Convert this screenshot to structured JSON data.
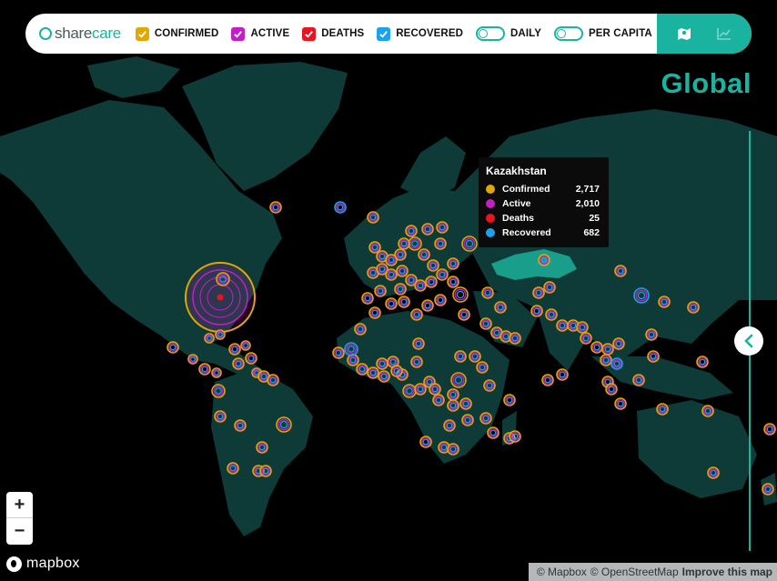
{
  "header": {
    "brand_part1": "share",
    "brand_part2": "care",
    "filters": [
      {
        "label": "CONFIRMED",
        "color": "#e0a800",
        "checked": true
      },
      {
        "label": "ACTIVE",
        "color": "#c41fc4",
        "checked": true
      },
      {
        "label": "DEATHS",
        "color": "#e8141f",
        "checked": true
      },
      {
        "label": "RECOVERED",
        "color": "#1aa3e8",
        "checked": true
      }
    ],
    "toggles": [
      {
        "label": "DAILY",
        "on": false
      },
      {
        "label": "PER CAPITA",
        "on": false
      }
    ],
    "views": [
      {
        "icon": "map-view-icon",
        "active": true
      },
      {
        "icon": "chart-view-icon",
        "active": false
      }
    ]
  },
  "region_title": "Global",
  "tooltip": {
    "country": "Kazakhstan",
    "rows": [
      {
        "label": "Confirmed",
        "value": "2,717",
        "color": "#e0a800"
      },
      {
        "label": "Active",
        "value": "2,010",
        "color": "#c41fc4"
      },
      {
        "label": "Deaths",
        "value": "25",
        "color": "#e8141f"
      },
      {
        "label": "Recovered",
        "value": "682",
        "color": "#1aa3e8"
      }
    ]
  },
  "map": {
    "land_color": "#0e3b37",
    "highlight_color": "#1a9e8c",
    "water_color": "#000000"
  },
  "zoom": {
    "in_label": "+",
    "out_label": "−"
  },
  "mapbox_label": "mapbox",
  "attribution": {
    "mapbox": "© Mapbox",
    "osm": "© OpenStreetMap",
    "improve": "Improve this map"
  }
}
